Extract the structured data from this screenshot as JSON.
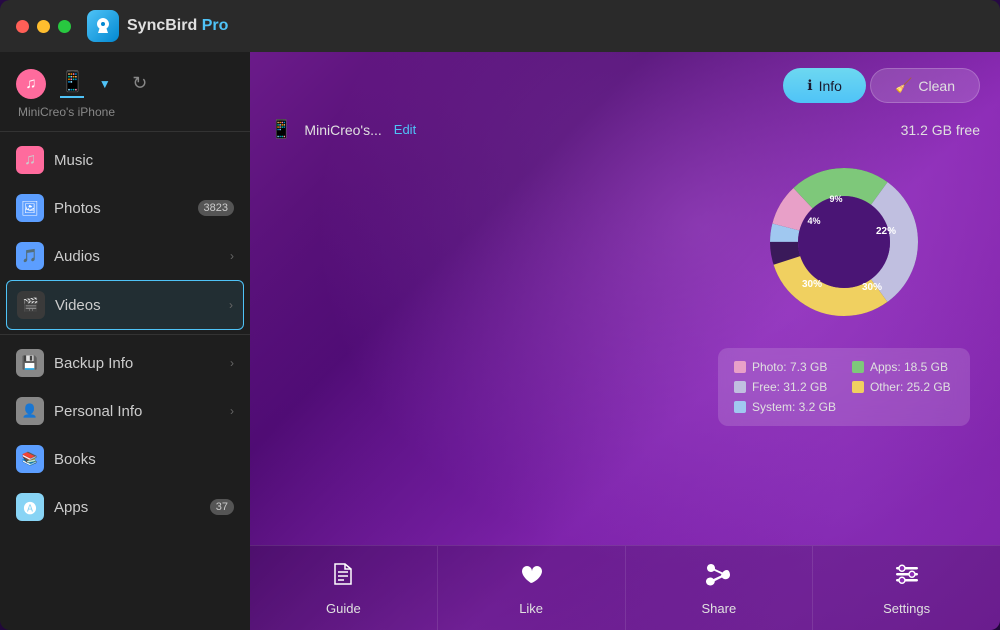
{
  "app": {
    "name": "SyncBird",
    "name_suffix": " Pro",
    "logo_icon": "🐦"
  },
  "titlebar": {
    "traffic_lights": [
      "red",
      "yellow",
      "green"
    ]
  },
  "device": {
    "name": "MiniCreo's iPhone",
    "display_name": "MiniCreo's...",
    "edit_label": "Edit",
    "storage": "31.2 GB free"
  },
  "toolbar": {
    "info_label": "Info",
    "clean_label": "Clean"
  },
  "nav": {
    "device_label": "MiniCreo's iPhone",
    "items": [
      {
        "id": "music",
        "label": "Music",
        "badge": "",
        "has_chevron": false
      },
      {
        "id": "photos",
        "label": "Photos",
        "badge": "3823",
        "has_chevron": false
      },
      {
        "id": "audios",
        "label": "Audios",
        "badge": "",
        "has_chevron": true
      },
      {
        "id": "videos",
        "label": "Videos",
        "badge": "",
        "has_chevron": true,
        "active": true
      },
      {
        "id": "backup",
        "label": "Backup Info",
        "badge": "",
        "has_chevron": true
      },
      {
        "id": "personal",
        "label": "Personal Info",
        "badge": "",
        "has_chevron": true
      },
      {
        "id": "books",
        "label": "Books",
        "badge": "",
        "has_chevron": false
      },
      {
        "id": "apps",
        "label": "Apps",
        "badge": "37",
        "has_chevron": false
      }
    ]
  },
  "chart": {
    "segments": [
      {
        "label": "Photo",
        "value": 7.3,
        "unit": "GB",
        "color": "#e8a0c8",
        "percent": 9
      },
      {
        "label": "Apps",
        "value": 18.5,
        "unit": "GB",
        "color": "#7ec87a",
        "percent": 22
      },
      {
        "label": "Free",
        "value": 31.2,
        "unit": "GB",
        "color": "#c0bfe0",
        "percent": 30
      },
      {
        "label": "Other",
        "value": 25.2,
        "unit": "GB",
        "color": "#f0d060",
        "percent": 30
      },
      {
        "label": "System",
        "value": 3.2,
        "unit": "GB",
        "color": "#a0c8f0",
        "percent": 4
      }
    ]
  },
  "bottom_bar": {
    "buttons": [
      {
        "id": "guide",
        "label": "Guide",
        "icon": "📖"
      },
      {
        "id": "like",
        "label": "Like",
        "icon": "♥"
      },
      {
        "id": "share",
        "label": "Share",
        "icon": "🐦"
      },
      {
        "id": "settings",
        "label": "Settings",
        "icon": "⚙"
      }
    ]
  }
}
